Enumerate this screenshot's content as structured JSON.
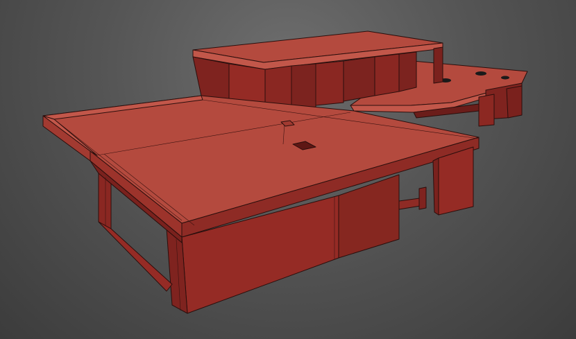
{
  "viewport": {
    "background_top": "#6e6e6e",
    "background_bottom": "#3c3c3c"
  },
  "model": {
    "description_visible": false,
    "colors": {
      "top_face": "#b44a3e",
      "front_face": "#952b25",
      "side_face": "#7f231f",
      "dark_face": "#6b1d1a",
      "rim": "#c2574a",
      "edge": "#2a0e0c"
    }
  }
}
